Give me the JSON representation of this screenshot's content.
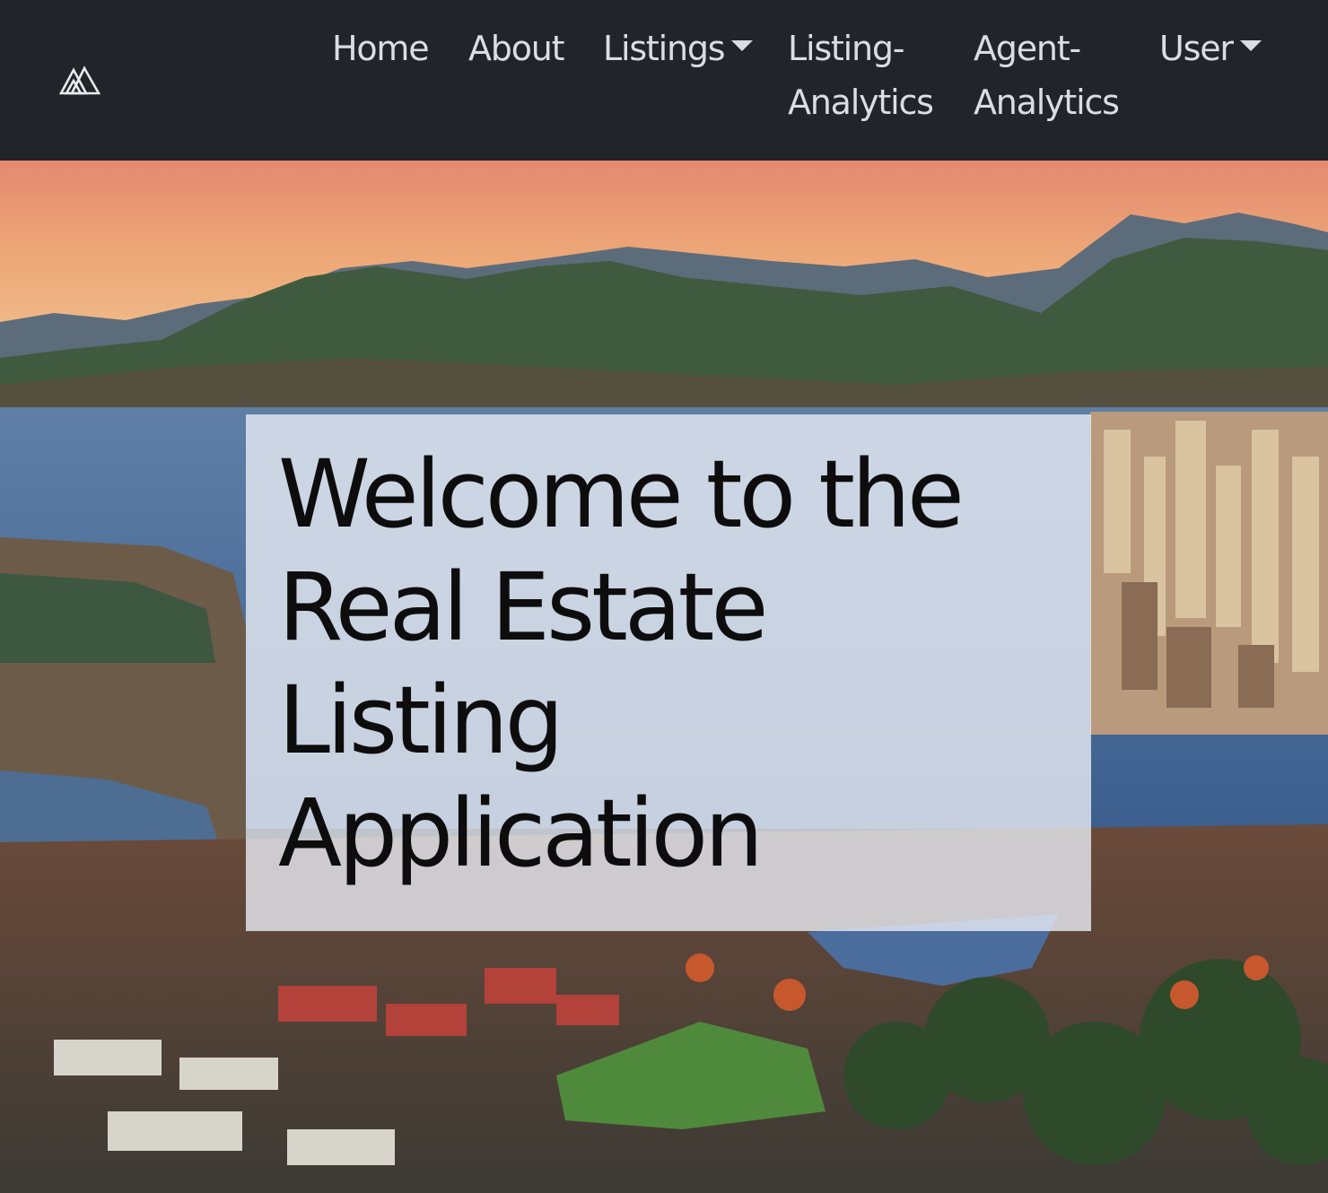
{
  "navbar": {
    "brand_icon": "mountain-triangles-logo",
    "items": [
      {
        "label": "Home",
        "dropdown": false
      },
      {
        "label": "About",
        "dropdown": false
      },
      {
        "label": "Listings",
        "dropdown": true
      },
      {
        "label_line1": "Listing-",
        "label_line2": "Analytics",
        "dropdown": false
      },
      {
        "label_line1": "Agent-",
        "label_line2": "Analytics",
        "dropdown": false
      },
      {
        "label": "User",
        "dropdown": true
      }
    ]
  },
  "hero": {
    "background_image": "aerial-city-harbour-mountains-sunset",
    "title": "Welcome to the Real Estate Listing Application"
  },
  "colors": {
    "navbar_bg": "#212529",
    "nav_text": "#dcdde0",
    "overlay_bg": "#e8ecf4"
  }
}
